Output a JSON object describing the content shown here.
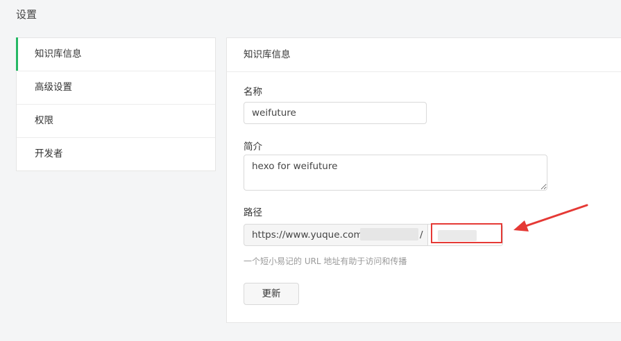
{
  "page": {
    "title": "设置"
  },
  "sidebar": {
    "items": [
      {
        "label": "知识库信息",
        "active": true
      },
      {
        "label": "高级设置",
        "active": false
      },
      {
        "label": "权限",
        "active": false
      },
      {
        "label": "开发者",
        "active": false
      }
    ]
  },
  "panel": {
    "title": "知识库信息",
    "name_label": "名称",
    "name_value": "weifuture",
    "intro_label": "简介",
    "intro_value": "hexo for weifuture",
    "path_label": "路径",
    "path_prefix": "https://www.yuque.com/",
    "path_separator": "/",
    "path_hint": "一个短小易记的 URL 地址有助于访问和传播",
    "update_button": "更新"
  },
  "annotation": {
    "color": "#e53935"
  },
  "colors": {
    "accent": "#25b864"
  }
}
